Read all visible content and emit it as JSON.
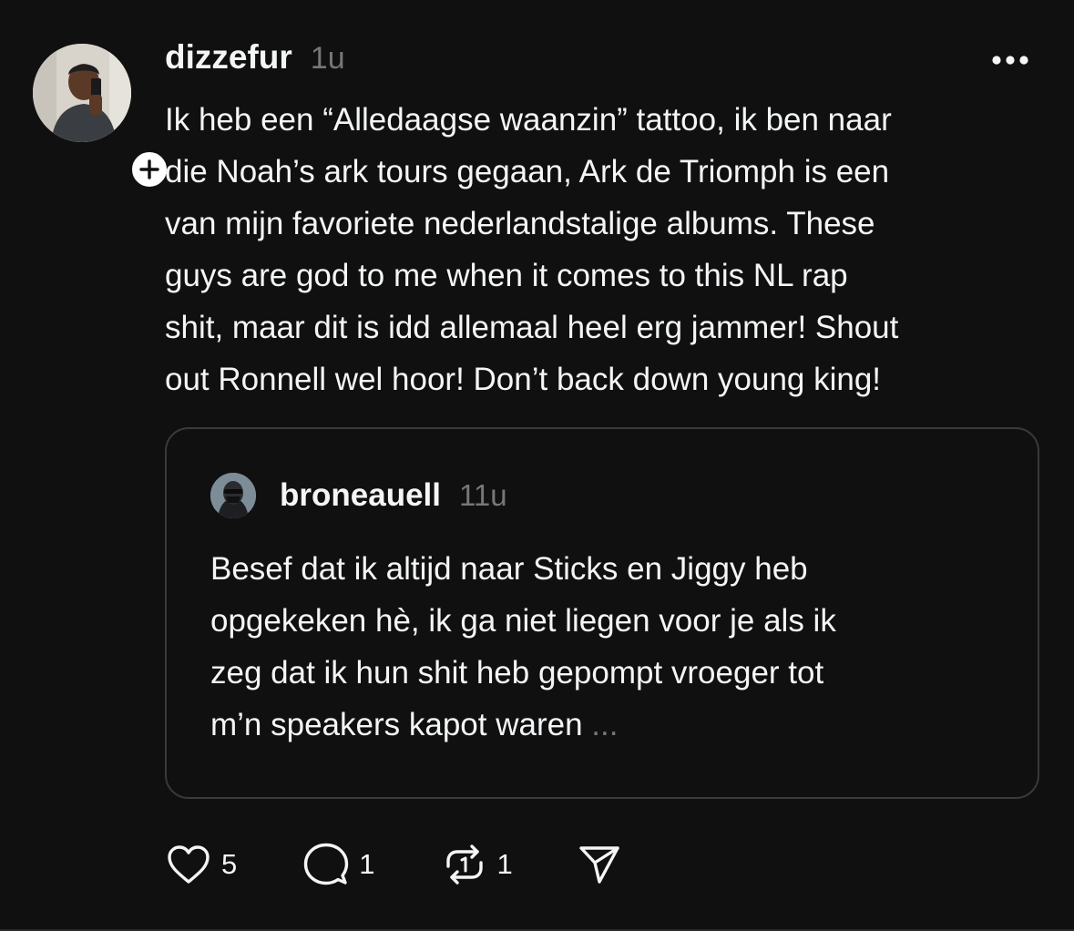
{
  "post": {
    "username": "dizzefur",
    "timestamp": "1u",
    "text_lines": [
      "Ik heb een “Alledaagse waanzin” tattoo, ik ben naar",
      "die Noah’s ark tours gegaan, Ark de Triomph is een",
      "van mijn favoriete nederlandstalige albums. These",
      "guys are god to me when it comes to this NL rap",
      "shit, maar dit is idd allemaal heel erg jammer! Shout",
      "out Ronnell wel hoor! Don’t back down young king!"
    ]
  },
  "quote": {
    "username": "broneauell",
    "timestamp": "11u",
    "text_lines": [
      "Besef dat ik altijd naar Sticks en Jiggy heb",
      "opgekeken hè, ik ga niet liegen voor je als ik",
      "zeg dat ik hun shit heb gepompt vroeger tot",
      "m’n speakers kapot waren"
    ],
    "ellipsis": "..."
  },
  "actions": {
    "likes": "5",
    "replies": "1",
    "reposts": "1"
  },
  "icons": {
    "more": "more-horizontal-icon",
    "follow": "plus-icon",
    "like": "heart-icon",
    "reply": "comment-icon",
    "repost": "repost-icon",
    "share": "send-icon"
  },
  "colors": {
    "background": "#101010",
    "text": "#f3f5f7",
    "muted": "#777777",
    "border": "#3a3a3a"
  }
}
